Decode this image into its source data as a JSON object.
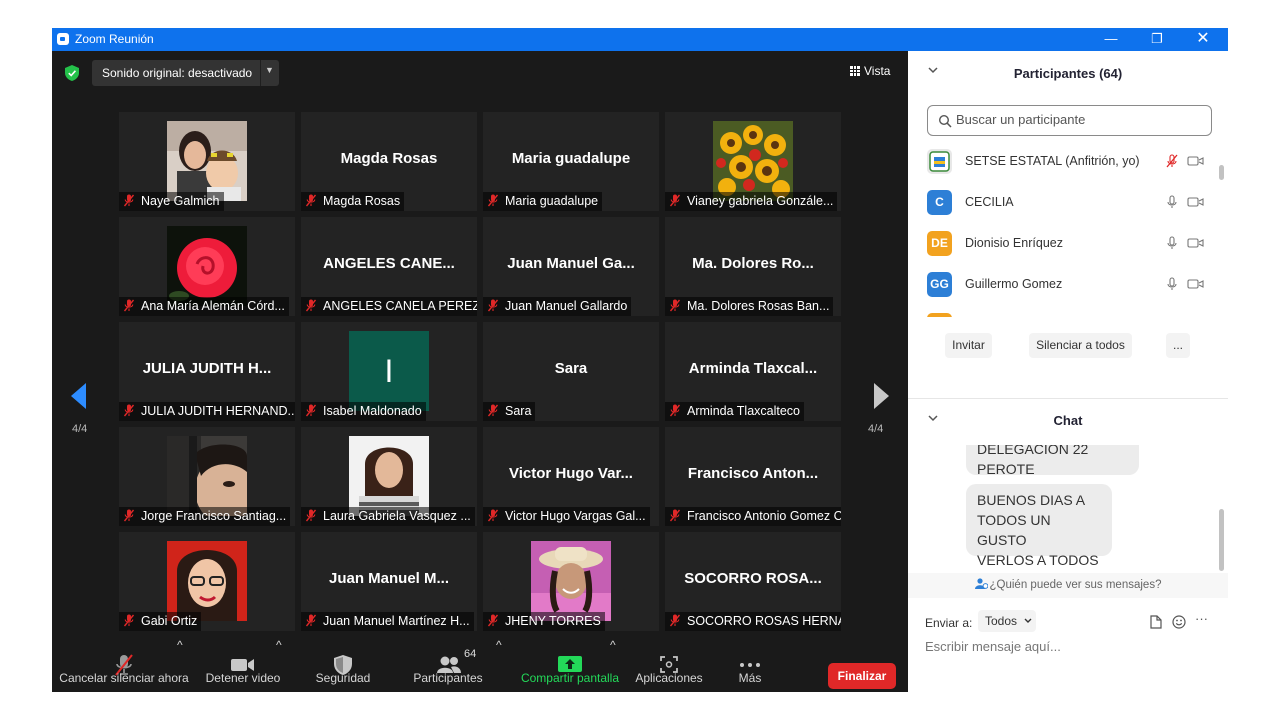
{
  "window": {
    "title": "Zoom Reunión",
    "min": "—",
    "max": "❐",
    "close": "✕"
  },
  "top": {
    "sound": "Sonido original: desactivado",
    "view": "Vista"
  },
  "page": {
    "left": "4/4",
    "right": "4/4"
  },
  "tiles": [
    {
      "big": "",
      "label": "Naye Galmich",
      "photo": "photo-woman-child-icon"
    },
    {
      "big": "Magda Rosas",
      "label": "Magda Rosas"
    },
    {
      "big": "Maria guadalupe",
      "label": "Maria guadalupe"
    },
    {
      "big": "",
      "label": "Vianey gabriela Gonzále...",
      "photo": "sunflowers-icon"
    },
    {
      "big": "",
      "label": "Ana María Alemán Córd...",
      "photo": "red-rose-icon"
    },
    {
      "big": "ANGELES CANE...",
      "label": "ANGELES CANELA PEREZ"
    },
    {
      "big": "Juan Manuel Ga...",
      "label": "Juan Manuel Gallardo"
    },
    {
      "big": "Ma. Dolores  Ro...",
      "label": "Ma. Dolores  Rosas Ban..."
    },
    {
      "big": "JULIA JUDITH H...",
      "label": "JULIA JUDITH HERNAND..."
    },
    {
      "big": "",
      "label": "Isabel Maldonado",
      "avatar": "I"
    },
    {
      "big": "Sara",
      "label": "Sara"
    },
    {
      "big": "Arminda  Tlaxcal...",
      "label": "Arminda Tlaxcalteco"
    },
    {
      "big": "",
      "label": "Jorge Francisco Santiag...",
      "photo": "photo-face-icon"
    },
    {
      "big": "",
      "label": "Laura Gabriela Vasquez ...",
      "photo": "photo-woman-icon"
    },
    {
      "big": "Victor Hugo Var...",
      "label": "Victor Hugo Vargas Gal..."
    },
    {
      "big": "Francisco  Anton...",
      "label": "Francisco Antonio Gomez C..."
    },
    {
      "big": "",
      "label": "Gabi Ortiz",
      "photo": "photo-woman-glasses-icon"
    },
    {
      "big": "Juan Manuel  M...",
      "label": "Juan Manuel Martínez H..."
    },
    {
      "big": "",
      "label": "JHENY TORRES",
      "photo": "photo-woman-hat-icon"
    },
    {
      "big": "SOCORRO  ROSA...",
      "label": "SOCORRO ROSAS HERNA..."
    }
  ],
  "toolbar": {
    "unmute": "Cancelar silenciar ahora",
    "video": "Detener video",
    "security": "Seguridad",
    "participants": "Participantes",
    "participants_count": "64",
    "share": "Compartir pantalla",
    "apps": "Aplicaciones",
    "more": "Más",
    "end": "Finalizar"
  },
  "participants_panel": {
    "title": "Participantes (64)",
    "search_placeholder": "Buscar un participante",
    "list": [
      {
        "initials": "",
        "name": "SETSE ESTATAL (Anfitrión, yo)",
        "color": "#e8e8e8"
      },
      {
        "initials": "C",
        "name": "CECILIA",
        "color": "#2d7fd6"
      },
      {
        "initials": "DE",
        "name": "Dionisio Enríquez",
        "color": "#f2a21f"
      },
      {
        "initials": "GG",
        "name": "Guillermo Gomez",
        "color": "#2d7fd6"
      }
    ],
    "invite": "Invitar",
    "mute_all": "Silenciar a todos",
    "more": "..."
  },
  "chat": {
    "title": "Chat",
    "messages": [
      {
        "line1": "DELEGACION 22",
        "line2": "PEROTE"
      },
      {
        "line1": "BUENOS DIAS A",
        "line2": "TODOS UN GUSTO",
        "line3": "VERLOS A TODOS"
      }
    ],
    "who_sees": "¿Quién puede ver sus mensajes?",
    "send_to_label": "Enviar a:",
    "send_to_value": "Todos",
    "input_placeholder": "Escribir mensaje aquí...",
    "more": "···"
  },
  "colors": {
    "titlebar": "#0e72ed",
    "end": "#e02828",
    "share": "#23d959",
    "muted": "#e02828"
  }
}
